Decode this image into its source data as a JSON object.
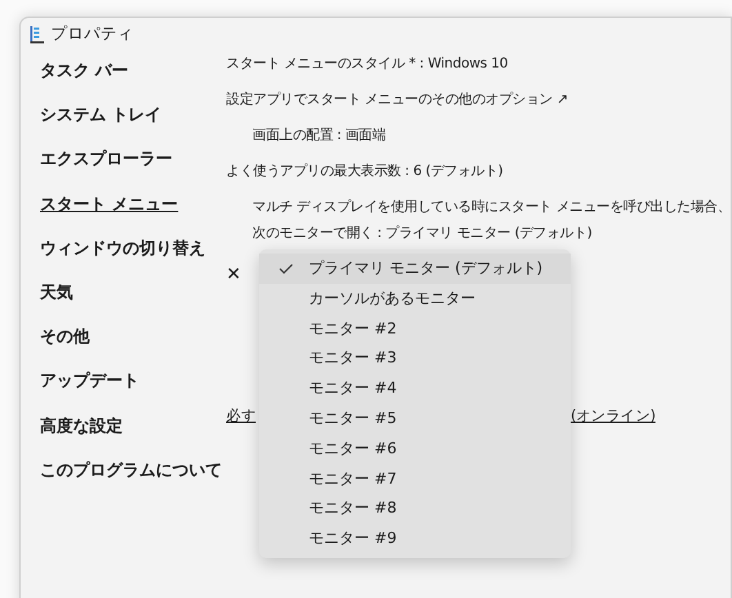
{
  "window": {
    "title": "プロパティ"
  },
  "sidebar": {
    "items": [
      {
        "label": "タスク バー",
        "selected": false
      },
      {
        "label": "システム トレイ",
        "selected": false
      },
      {
        "label": "エクスプローラー",
        "selected": false
      },
      {
        "label": "スタート メニュー",
        "selected": true
      },
      {
        "label": "ウィンドウの切り替え",
        "selected": false
      },
      {
        "label": "天気",
        "selected": false
      },
      {
        "label": "その他",
        "selected": false
      },
      {
        "label": "アップデート",
        "selected": false
      },
      {
        "label": "高度な設定",
        "selected": false
      },
      {
        "label": "このプログラムについて",
        "selected": false
      }
    ]
  },
  "settings": [
    {
      "text": "スタート メニューのスタイル * : Windows 10",
      "indented": false
    },
    {
      "text": "設定アプリでスタート メニューのその他のオプション ↗",
      "indented": false
    },
    {
      "text": "画面上の配置 : 画面端",
      "indented": true
    },
    {
      "text": "よく使うアプリの最大表示数 : 6 (デフォルト)",
      "indented": false
    },
    {
      "text": "マルチ ディスプレイを使用している時にスタート メニューを呼び出した場合、",
      "indented": true
    },
    {
      "text": "次のモニターで開く : プライマリ モニター (デフォルト)",
      "indented": true
    }
  ],
  "close_mark": "✕",
  "footer_link": {
    "left_part": "必す",
    "right_part": "(オンライン)"
  },
  "dropdown": {
    "items": [
      {
        "label": "プライマリ モニター (デフォルト)",
        "selected": true
      },
      {
        "label": "カーソルがあるモニター",
        "selected": false
      },
      {
        "label": "モニター #2",
        "selected": false
      },
      {
        "label": "モニター #3",
        "selected": false
      },
      {
        "label": "モニター #4",
        "selected": false
      },
      {
        "label": "モニター #5",
        "selected": false
      },
      {
        "label": "モニター #6",
        "selected": false
      },
      {
        "label": "モニター #7",
        "selected": false
      },
      {
        "label": "モニター #8",
        "selected": false
      },
      {
        "label": "モニター #9",
        "selected": false
      }
    ]
  }
}
